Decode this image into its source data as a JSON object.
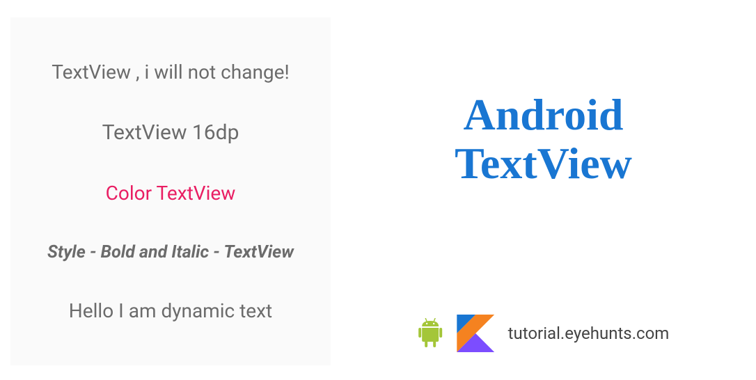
{
  "textviews": {
    "plain": "TextView , i will not change!",
    "sized": "TextView 16dp",
    "colored": "Color TextView",
    "styled": "Style - Bold and Italic - TextView",
    "dynamic": "Hello I am dynamic text"
  },
  "title": {
    "line1": "Android",
    "line2": "TextView"
  },
  "footer": {
    "website": "tutorial.eyehunts.com"
  },
  "colors": {
    "accent_pink": "#e91e63",
    "brand_blue": "#1976d2",
    "text_gray": "#6b6b6b"
  }
}
